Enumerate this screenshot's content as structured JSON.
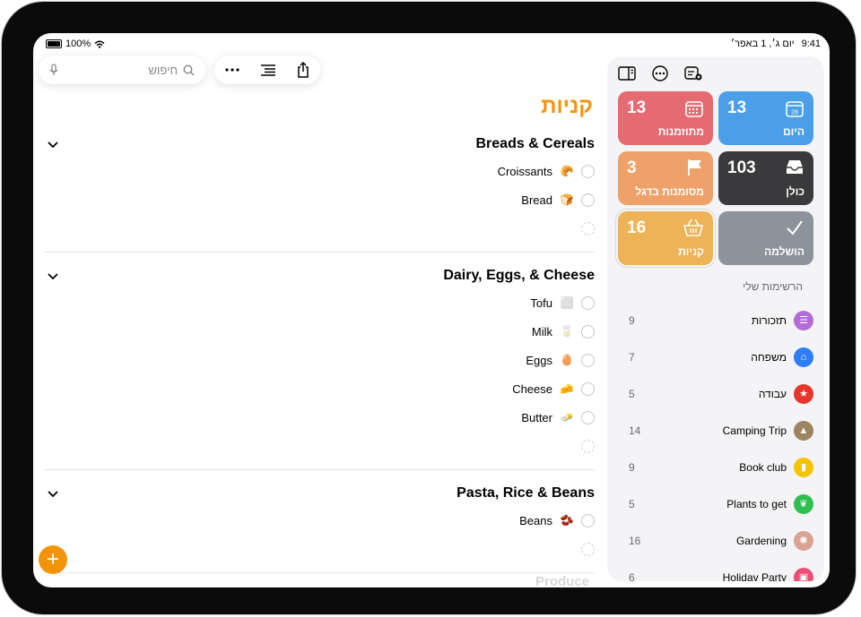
{
  "status": {
    "battery": "100%",
    "date": "יום ג׳, 1 באפר׳",
    "time": "9:41"
  },
  "search": {
    "placeholder": "חיפוש"
  },
  "list": {
    "title": "קניות",
    "sections": [
      {
        "title": "Breads & Cereals",
        "items": [
          {
            "label": "Croissants",
            "emoji": "🥐"
          },
          {
            "label": "Bread",
            "emoji": "🍞"
          }
        ]
      },
      {
        "title": "Dairy, Eggs, & Cheese",
        "items": [
          {
            "label": "Tofu",
            "emoji": "⬜"
          },
          {
            "label": "Milk",
            "emoji": "🥛"
          },
          {
            "label": "Eggs",
            "emoji": "🥚"
          },
          {
            "label": "Cheese",
            "emoji": "🧀"
          },
          {
            "label": "Butter",
            "emoji": "🧈"
          }
        ]
      },
      {
        "title": "Pasta, Rice & Beans",
        "items": [
          {
            "label": "Beans",
            "emoji": "🫘"
          }
        ]
      }
    ],
    "next_section": "Produce"
  },
  "smart_lists": [
    {
      "name": "היום",
      "count": "13",
      "color": "#4a9fe8",
      "icon": "calendar-today-icon"
    },
    {
      "name": "מתוזמנות",
      "count": "13",
      "color": "#e56a72",
      "icon": "calendar-icon"
    },
    {
      "name": "כולן",
      "count": "103",
      "color": "#3a3a3c",
      "icon": "tray-icon"
    },
    {
      "name": "מסומנות בדגל",
      "count": "3",
      "color": "#eea26a",
      "icon": "flag-icon"
    },
    {
      "name": "הושלמה",
      "count": "",
      "color": "#8d939b",
      "icon": "checkmark-icon"
    },
    {
      "name": "קניות",
      "count": "16",
      "color": "#eeb257",
      "icon": "basket-icon"
    }
  ],
  "my_lists_label": "הרשימות שלי",
  "my_lists": [
    {
      "name": "תזכורות",
      "count": "9",
      "color": "#b36bd6",
      "icon": "list-icon",
      "glyph": "☰"
    },
    {
      "name": "משפחה",
      "count": "7",
      "color": "#2e7cf6",
      "icon": "house-icon",
      "glyph": "⌂"
    },
    {
      "name": "עבודה",
      "count": "5",
      "color": "#e8352c",
      "icon": "star-icon",
      "glyph": "★"
    },
    {
      "name": "Camping Trip",
      "count": "14",
      "color": "#9c8461",
      "icon": "tent-icon",
      "glyph": "▲"
    },
    {
      "name": "Book club",
      "count": "9",
      "color": "#f5c400",
      "icon": "bookmark-icon",
      "glyph": "▮"
    },
    {
      "name": "Plants to get",
      "count": "5",
      "color": "#2fbf4f",
      "icon": "leaf-icon",
      "glyph": "❦"
    },
    {
      "name": "Gardening",
      "count": "16",
      "color": "#d9a394",
      "icon": "sun-icon",
      "glyph": "✺"
    },
    {
      "name": "Holiday Party",
      "count": "6",
      "color": "#ee4d76",
      "icon": "gift-icon",
      "glyph": "▣"
    }
  ]
}
